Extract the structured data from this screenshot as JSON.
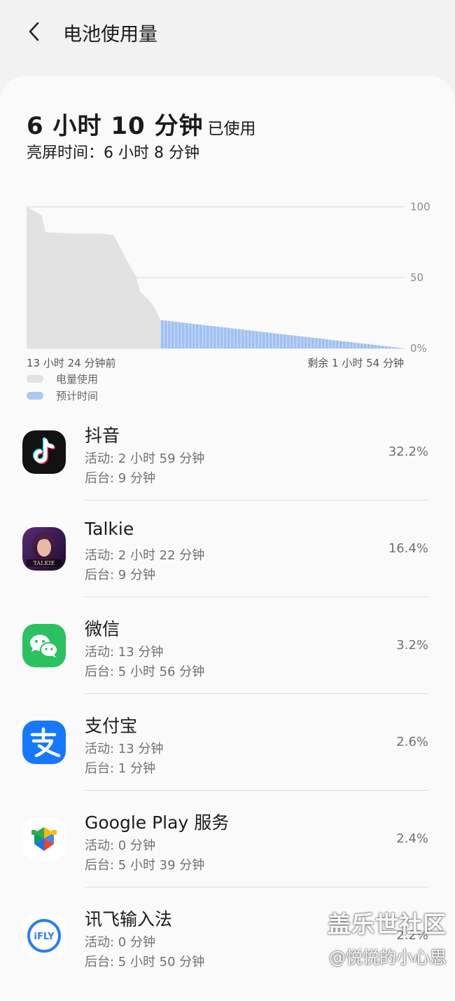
{
  "header": {
    "title": "电池使用量",
    "back_icon": "chevron-left-icon"
  },
  "summary": {
    "total_used": "6 小时 10 分钟",
    "used_suffix": "已使用",
    "screen_time": "亮屏时间：6 小时 8 分钟"
  },
  "chart_data": {
    "type": "area",
    "y_ticks": [
      "100",
      "50",
      "0%"
    ],
    "ylim": [
      0,
      100
    ],
    "x_start_label": "13 小时 24 分钟前",
    "x_end_label": "剩余 1 小时 54 分钟",
    "series": [
      {
        "name": "电量使用",
        "color": "#e2e2e2",
        "x_fraction": [
          0,
          0.04,
          0.05,
          0.12,
          0.2,
          0.23,
          0.25,
          0.27,
          0.29,
          0.3,
          0.32,
          0.33,
          0.34,
          0.355
        ],
        "values": [
          100,
          94,
          82,
          81,
          81,
          80,
          70,
          60,
          50,
          40,
          35,
          32,
          28,
          20
        ]
      },
      {
        "name": "预计时间",
        "color": "#a9c8f3",
        "x_fraction": [
          0.355,
          1
        ],
        "values": [
          20,
          0
        ]
      }
    ],
    "grid": true
  },
  "legend": [
    {
      "label": "电量使用",
      "color": "#e2e2e2"
    },
    {
      "label": "预计时间",
      "color": "#a9c8f3"
    }
  ],
  "apps": [
    {
      "name": "抖音",
      "icon": "douyin-icon",
      "active": "活动: 2 小时 59 分钟",
      "background": "后台: 9 分钟",
      "percent": "32.2%"
    },
    {
      "name": "Talkie",
      "icon": "talkie-icon",
      "active": "活动: 2 小时 22 分钟",
      "background": "后台: 9 分钟",
      "percent": "16.4%"
    },
    {
      "name": "微信",
      "icon": "wechat-icon",
      "active": "活动: 13 分钟",
      "background": "后台: 5 小时 56 分钟",
      "percent": "3.2%"
    },
    {
      "name": "支付宝",
      "icon": "alipay-icon",
      "active": "活动: 13 分钟",
      "background": "后台: 1 分钟",
      "percent": "2.6%"
    },
    {
      "name": "Google Play 服务",
      "icon": "google-play-services-icon",
      "active": "活动: 0 分钟",
      "background": "后台: 5 小时 39 分钟",
      "percent": "2.4%"
    },
    {
      "name": "讯飞输入法",
      "icon": "ifly-icon",
      "active": "活动: 0 分钟",
      "background": "后台: 5 小时 50 分钟",
      "percent": "2.2%"
    }
  ],
  "watermark": {
    "line1": "盖乐世社区",
    "line2": "@悦悦的小心思"
  },
  "icon_texts": {
    "talkie": "TALKIE",
    "ifly": "iFLY"
  }
}
